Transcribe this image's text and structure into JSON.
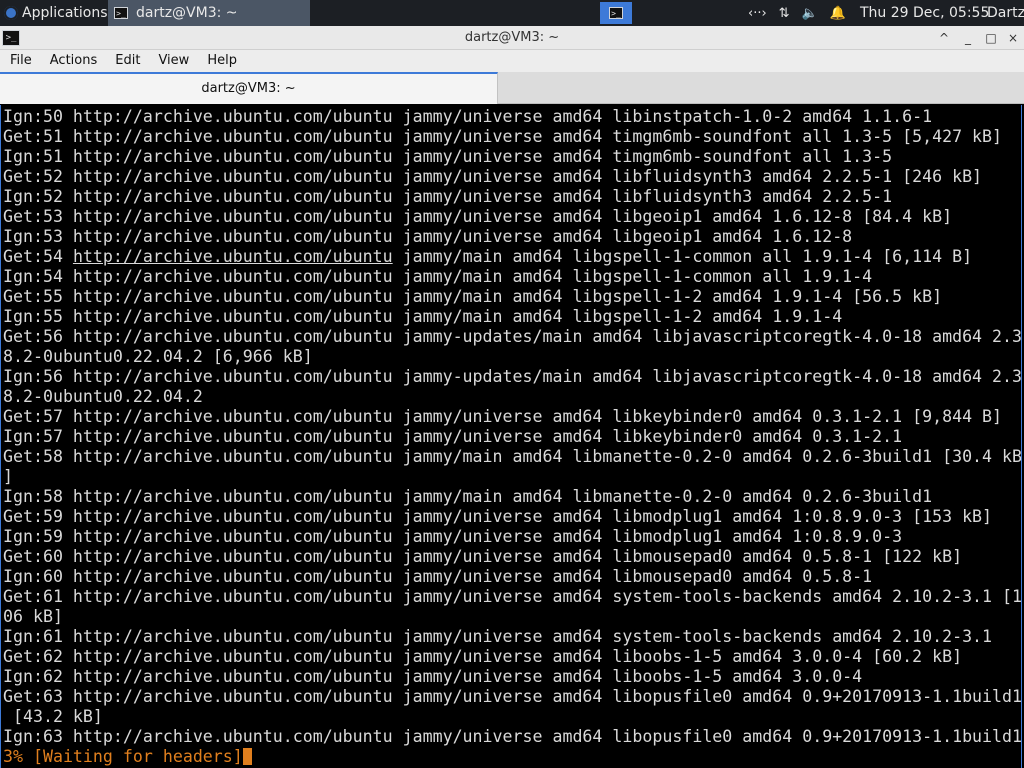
{
  "panel": {
    "applications_label": "Applications",
    "task_label": "dartz@VM3: ~",
    "clock": "Thu 29 Dec, 05:55",
    "user": "Dartz",
    "tray_icons": [
      "network-icon",
      "transfer-icon",
      "volume-icon",
      "notification-bell-icon"
    ]
  },
  "window": {
    "title": "dartz@VM3: ~",
    "controls": [
      "^",
      "_",
      "□",
      "×"
    ]
  },
  "menu": {
    "file": "File",
    "actions": "Actions",
    "edit": "Edit",
    "view": "View",
    "help": "Help"
  },
  "tabs": [
    {
      "label": "dartz@VM3: ~"
    }
  ],
  "terminal": {
    "lines": [
      "Ign:50 http://archive.ubuntu.com/ubuntu jammy/universe amd64 libinstpatch-1.0-2 amd64 1.1.6-1",
      "Get:51 http://archive.ubuntu.com/ubuntu jammy/universe amd64 timgm6mb-soundfont all 1.3-5 [5,427 kB]",
      "Ign:51 http://archive.ubuntu.com/ubuntu jammy/universe amd64 timgm6mb-soundfont all 1.3-5",
      "Get:52 http://archive.ubuntu.com/ubuntu jammy/universe amd64 libfluidsynth3 amd64 2.2.5-1 [246 kB]",
      "Ign:52 http://archive.ubuntu.com/ubuntu jammy/universe amd64 libfluidsynth3 amd64 2.2.5-1",
      "Get:53 http://archive.ubuntu.com/ubuntu jammy/universe amd64 libgeoip1 amd64 1.6.12-8 [84.4 kB]",
      "Ign:53 http://archive.ubuntu.com/ubuntu jammy/universe amd64 libgeoip1 amd64 1.6.12-8",
      "Get:54 http://archive.ubuntu.com/ubuntu jammy/main amd64 libgspell-1-common all 1.9.1-4 [6,114 B]",
      "Ign:54 http://archive.ubuntu.com/ubuntu jammy/main amd64 libgspell-1-common all 1.9.1-4",
      "Get:55 http://archive.ubuntu.com/ubuntu jammy/main amd64 libgspell-1-2 amd64 1.9.1-4 [56.5 kB]",
      "Ign:55 http://archive.ubuntu.com/ubuntu jammy/main amd64 libgspell-1-2 amd64 1.9.1-4",
      "Get:56 http://archive.ubuntu.com/ubuntu jammy-updates/main amd64 libjavascriptcoregtk-4.0-18 amd64 2.3",
      "8.2-0ubuntu0.22.04.2 [6,966 kB]",
      "Ign:56 http://archive.ubuntu.com/ubuntu jammy-updates/main amd64 libjavascriptcoregtk-4.0-18 amd64 2.3",
      "8.2-0ubuntu0.22.04.2",
      "Get:57 http://archive.ubuntu.com/ubuntu jammy/universe amd64 libkeybinder0 amd64 0.3.1-2.1 [9,844 B]",
      "Ign:57 http://archive.ubuntu.com/ubuntu jammy/universe amd64 libkeybinder0 amd64 0.3.1-2.1",
      "Get:58 http://archive.ubuntu.com/ubuntu jammy/main amd64 libmanette-0.2-0 amd64 0.2.6-3build1 [30.4 kB",
      "]",
      "Ign:58 http://archive.ubuntu.com/ubuntu jammy/main amd64 libmanette-0.2-0 amd64 0.2.6-3build1",
      "Get:59 http://archive.ubuntu.com/ubuntu jammy/universe amd64 libmodplug1 amd64 1:0.8.9.0-3 [153 kB]",
      "Ign:59 http://archive.ubuntu.com/ubuntu jammy/universe amd64 libmodplug1 amd64 1:0.8.9.0-3",
      "Get:60 http://archive.ubuntu.com/ubuntu jammy/universe amd64 libmousepad0 amd64 0.5.8-1 [122 kB]",
      "Ign:60 http://archive.ubuntu.com/ubuntu jammy/universe amd64 libmousepad0 amd64 0.5.8-1",
      "Get:61 http://archive.ubuntu.com/ubuntu jammy/universe amd64 system-tools-backends amd64 2.10.2-3.1 [1",
      "06 kB]",
      "Ign:61 http://archive.ubuntu.com/ubuntu jammy/universe amd64 system-tools-backends amd64 2.10.2-3.1",
      "Get:62 http://archive.ubuntu.com/ubuntu jammy/universe amd64 liboobs-1-5 amd64 3.0.0-4 [60.2 kB]",
      "Ign:62 http://archive.ubuntu.com/ubuntu jammy/universe amd64 liboobs-1-5 amd64 3.0.0-4",
      "Get:63 http://archive.ubuntu.com/ubuntu jammy/universe amd64 libopusfile0 amd64 0.9+20170913-1.1build1",
      " [43.2 kB]",
      "Ign:63 http://archive.ubuntu.com/ubuntu jammy/universe amd64 libopusfile0 amd64 0.9+20170913-1.1build1"
    ],
    "hovered_link_line": 7,
    "hovered_link_text": "http://archive.ubuntu.com/ubuntu",
    "status_line": "3% [Waiting for headers]",
    "status_color": "#e07f1e"
  }
}
